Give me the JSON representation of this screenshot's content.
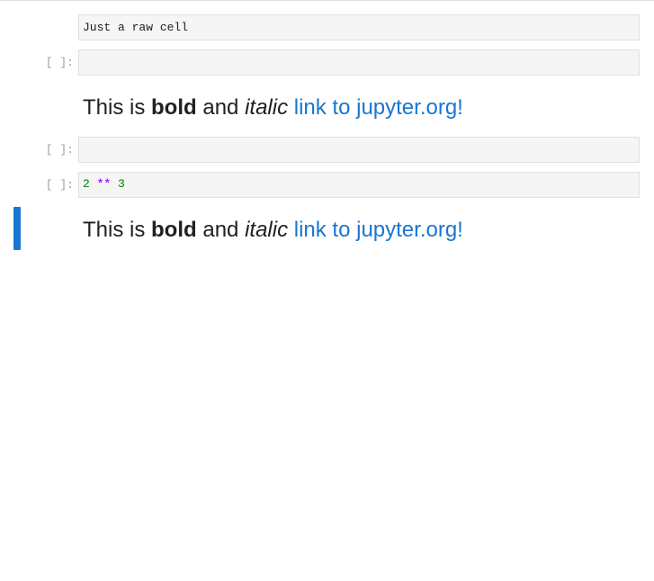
{
  "cells": [
    {
      "type": "raw",
      "prompt": "",
      "text": "Just a raw cell"
    },
    {
      "type": "code",
      "prompt": "[ ]:",
      "text": ""
    },
    {
      "type": "markdown",
      "parts": {
        "t1": "This is ",
        "bold": "bold",
        "t2": " and ",
        "italic": "italic",
        "t3": " ",
        "link": "link to jupyter.org!"
      }
    },
    {
      "type": "code",
      "prompt": "[ ]:",
      "text": ""
    },
    {
      "type": "code",
      "prompt": "[ ]:",
      "tokens": {
        "a": "2",
        "sp1": " ",
        "op": "**",
        "sp2": " ",
        "b": "3"
      }
    },
    {
      "type": "markdown",
      "active": true,
      "parts": {
        "t1": "This is ",
        "bold": "bold",
        "t2": " and ",
        "italic": "italic",
        "t3": " ",
        "link": "link to jupyter.org!"
      }
    }
  ],
  "colors": {
    "link": "#1976d2",
    "active_bar": "#1976d2",
    "number": "#008000",
    "operator": "#aa22ff"
  }
}
